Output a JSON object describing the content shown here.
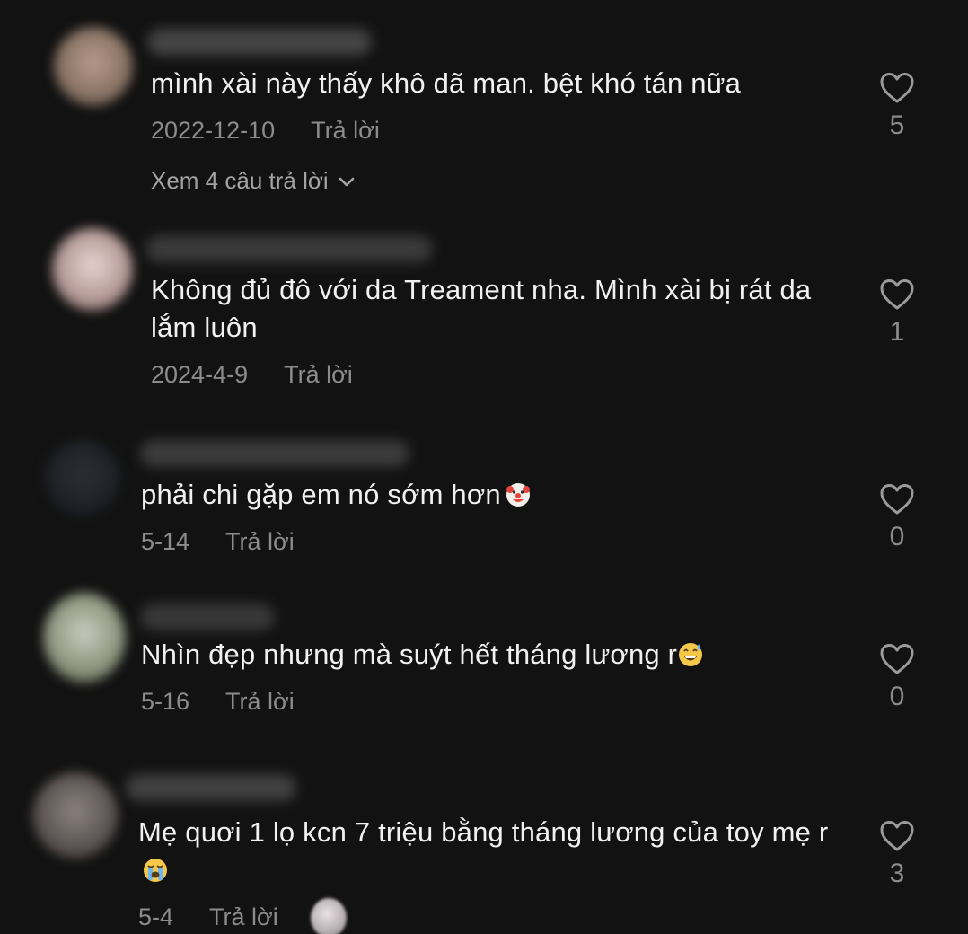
{
  "comments": [
    {
      "text": "mình xài này thấy khô dã man. bệt khó tán nữa",
      "date": "2022-12-10",
      "reply_label": "Trả lời",
      "like_count": "5",
      "view_replies": "Xem 4 câu trả lời"
    },
    {
      "text": "Không đủ đô với da Treament nha. Mình xài bị rát da lắm luôn",
      "date": "2024-4-9",
      "reply_label": "Trả lời",
      "like_count": "1"
    },
    {
      "text": "phải chi gặp em nó sớm hơn",
      "emoji": "clown-face",
      "date": "5-14",
      "reply_label": "Trả lời",
      "like_count": "0"
    },
    {
      "text": "Nhìn đẹp nhưng mà suýt hết tháng lương r",
      "emoji": "grinning-sweat-face",
      "date": "5-16",
      "reply_label": "Trả lời",
      "like_count": "0"
    },
    {
      "text": "Mẹ quơi 1 lọ kcn 7 triệu bằng tháng lương của toy mẹ r",
      "emoji": "loudly-crying-face",
      "date": "5-4",
      "reply_label": "Trả lời",
      "like_count": "3"
    }
  ],
  "colors": {
    "background": "#121212",
    "text": "#f1f1f1",
    "meta": "#8c8c8c"
  }
}
